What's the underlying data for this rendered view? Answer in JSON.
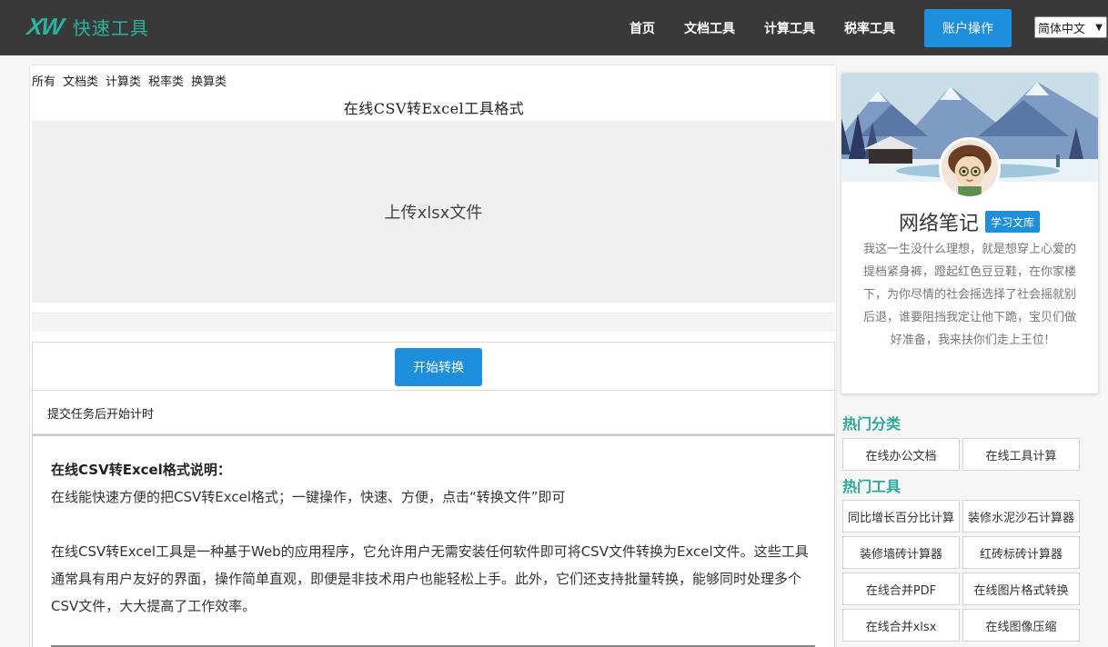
{
  "header": {
    "logo_mark": "XW",
    "logo_text": "快速工具",
    "nav": [
      "首页",
      "文档工具",
      "计算工具",
      "税率工具"
    ],
    "account_button": "账户操作",
    "language": "简体中文"
  },
  "main": {
    "categories": [
      "所有",
      "文档类",
      "计算类",
      "税率类",
      "换算类"
    ],
    "title": "在线CSV转Excel工具格式",
    "upload_label": "上传xlsx文件",
    "convert_button": "开始转换",
    "timer_text": "提交任务后开始计时",
    "description": {
      "title": "在线CSV转Excel格式说明：",
      "line": "在线能快速方便的把CSV转Excel格式；一键操作，快速、方便，点击“转换文件”即可",
      "paragraph": "在线CSV转Excel工具是一种基于Web的应用程序，它允许用户无需安装任何软件即可将CSV文件转换为Excel文件。这些工具通常具有用户友好的界面，操作简单直观，即便是非技术用户也能轻松上手。此外，它们还支持批量转换，能够同时处理多个CSV文件，大大提高了工作效率。"
    }
  },
  "sidebar": {
    "profile": {
      "name": "网络笔记",
      "badge": "学习文库",
      "bio": "我这一生没什么理想，就是想穿上心爱的提档紧身裤，蹬起红色豆豆鞋，在你家楼下，为你尽情的社会摇选择了社会摇就别后退，谁要阻挡我定让他下跪，宝贝们做好准备，我来扶你们走上王位!"
    },
    "hot_categories_title": "热门分类",
    "hot_categories": [
      "在线办公文档",
      "在线工具计算"
    ],
    "hot_tools_title": "热门工具",
    "hot_tools": [
      "同比增长百分比计算",
      "装修水泥沙石计算器",
      "装修墙砖计算器",
      "红砖标砖计算器",
      "在线合并PDF",
      "在线图片格式转换",
      "在线合并xlsx",
      "在线图像压缩"
    ]
  }
}
